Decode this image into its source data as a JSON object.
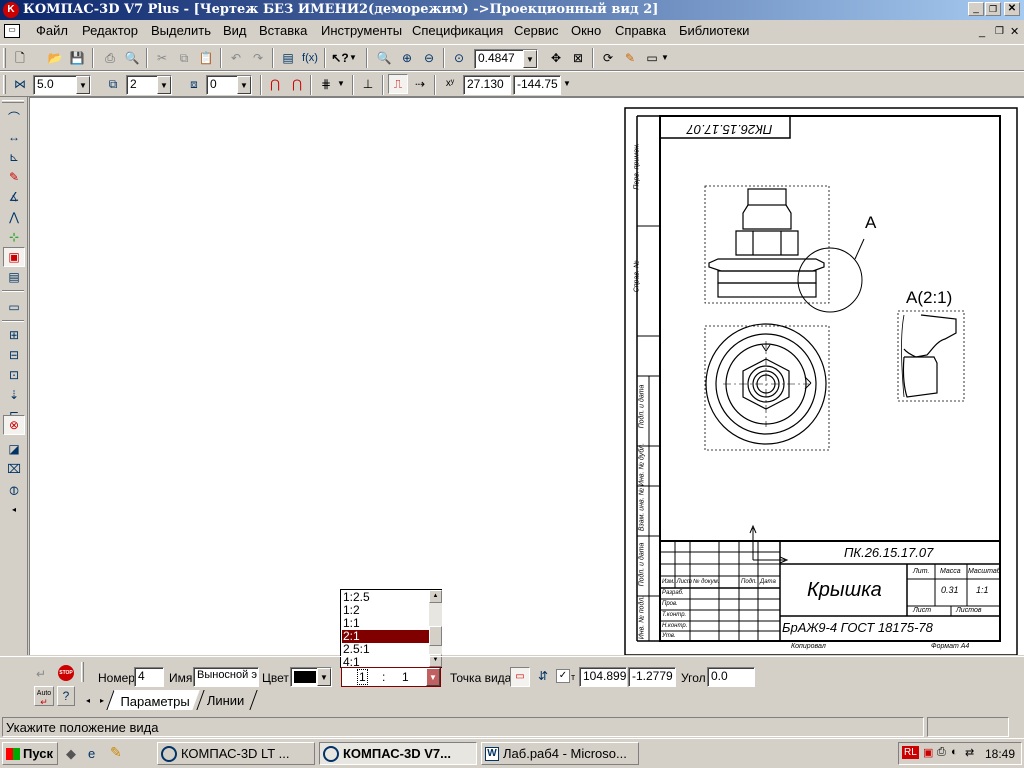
{
  "window": {
    "title": "КОМПАС-3D V7 Plus - [Чертеж БЕЗ ИМЕНИ2(деморежим) ->Проекционный вид 2]"
  },
  "menu": [
    "Файл",
    "Редактор",
    "Выделить",
    "Вид",
    "Вставка",
    "Инструменты",
    "Спецификация",
    "Сервис",
    "Окно",
    "Справка",
    "Библиотеки"
  ],
  "toolbar": {
    "zoom_value": "0.4847",
    "line_step": "5.0",
    "layer_value": "2",
    "style_value": "0",
    "coord_x": "27.130",
    "coord_y": "-144.75"
  },
  "drawing": {
    "doc_code_top": "ПК26.15.17.07",
    "doc_code": "ПК.26.15.17.07",
    "part_name": "Крышка",
    "material": "БрАЖ9-4 ГОСТ 18175-78",
    "mass": "0.31",
    "scale": "1:1",
    "view_a_label": "А",
    "view_a_scaled": "А(2:1)",
    "side_labels": [
      "Перв. примен.",
      "Справ. №",
      "Подп. и дата",
      "Инв. № дубл.",
      "Взам. инв. №",
      "Подп. и дата",
      "Инв. № подл."
    ],
    "title_block": {
      "lit": "Лит.",
      "mass_h": "Масса",
      "scale_h": "Масштаб",
      "sheet": "Лист",
      "sheets": "Листов",
      "izm": "Изм. Лист",
      "ndoc": "№ докум.",
      "podp": "Подп.",
      "data": "Дата",
      "razrab": "Разраб.",
      "prov": "Пров.",
      "tkontr": "Т.контр.",
      "nkontr": "Н.контр.",
      "utv": "Утв.",
      "kopiroval": "Копировал",
      "format": "Формат А4"
    }
  },
  "scale_list": {
    "options": [
      "1:2.5",
      "1:2",
      "1:1",
      "2:1",
      "2.5:1",
      "4:1"
    ],
    "selected": "2:1"
  },
  "properties": {
    "number_label": "Номер",
    "number_value": "4",
    "name_label": "Имя",
    "name_value": "Выносной э",
    "color_label": "Цвет",
    "scale_left": "1",
    "scale_sep": ":",
    "scale_right": "1",
    "point_label": "Точка вида",
    "point_x": "104.899",
    "point_y": "-1.2779",
    "angle_label": "Угол",
    "angle_value": "0.0",
    "tabs": [
      "Параметры",
      "Линии"
    ],
    "auto_label": "Auto",
    "stop_label": "STOP"
  },
  "status": {
    "text": "Укажите положение вида"
  },
  "taskbar": {
    "start": "Пуск",
    "tasks": [
      "КОМПАС-3D LT ...",
      "КОМПАС-3D V7...",
      "Лаб.раб4 - Microso..."
    ],
    "clock": "18:49",
    "lang": "RL"
  },
  "colors": {
    "title_bar": "#0a246a",
    "taskbar": "#d4d0c8",
    "selected": "#800000"
  }
}
